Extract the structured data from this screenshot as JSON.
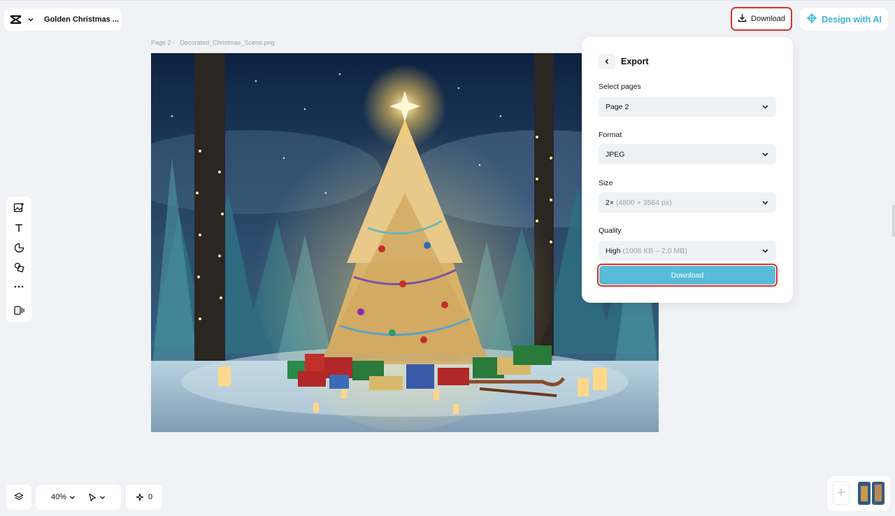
{
  "header": {
    "document_title": "Golden Christmas ...",
    "download_label": "Download",
    "design_ai_label": "Design with AI",
    "logo_icon": "capcut-logo-icon",
    "menu_icon": "chevron-down-icon"
  },
  "canvas": {
    "page_label": "Page 2 -",
    "file_name": "Decorated_Christmas_Scene.png",
    "image_description": "Decorated Christmas tree in a snowy forest at night with gifts, a sled, and lanterns"
  },
  "left_toolbar": {
    "tools": [
      {
        "name": "add-image-icon"
      },
      {
        "name": "text-icon"
      },
      {
        "name": "sticker-icon"
      },
      {
        "name": "shapes-icon"
      },
      {
        "name": "more-icon"
      },
      {
        "name": "panel-toggle-icon"
      }
    ]
  },
  "export_panel": {
    "title": "Export",
    "select_pages_label": "Select pages",
    "select_pages_value": "Page 2",
    "format_label": "Format",
    "format_value": "JPEG",
    "size_label": "Size",
    "size_value": "2×",
    "size_detail": "(4800 × 3584 px)",
    "quality_label": "Quality",
    "quality_value": "High",
    "quality_detail": "(1008 KB – 2.0 MB)",
    "download_label": "Download"
  },
  "bottom_bar": {
    "zoom_value": "40%",
    "ai_count": "0"
  },
  "colors": {
    "accent": "#58bcd6",
    "ai_text": "#3cb4d8",
    "highlight_border": "#d9302c",
    "background": "#f0f2f5"
  }
}
